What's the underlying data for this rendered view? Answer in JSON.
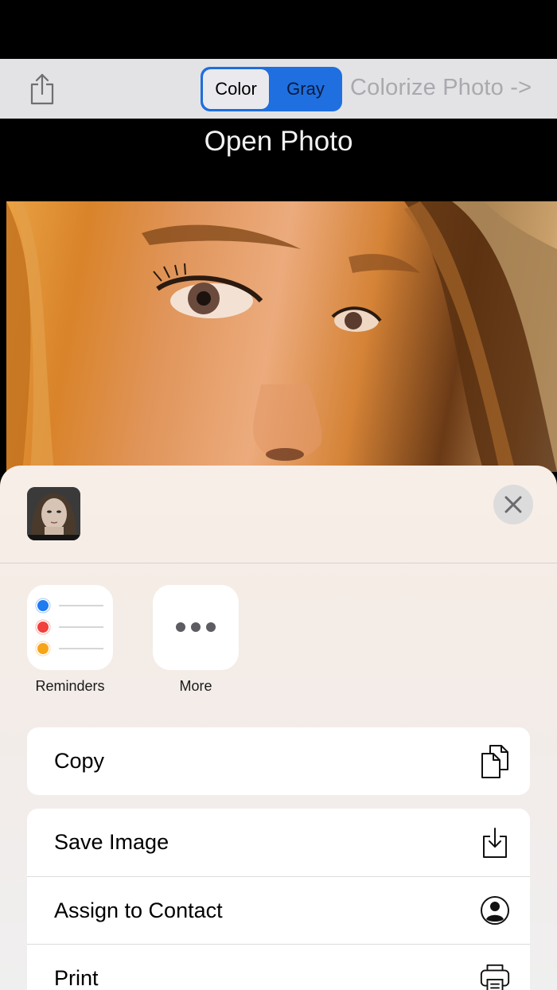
{
  "toolbar": {
    "share_icon": "share-icon",
    "segment_color": "Color",
    "segment_gray": "Gray",
    "selected_segment": "Color",
    "colorize_label": "Colorize Photo ->",
    "accent": "#1f6fe0"
  },
  "main": {
    "open_photo_label": "Open Photo"
  },
  "share_sheet": {
    "close_icon": "close-icon",
    "apps": [
      {
        "label": "Reminders",
        "icon": "reminders-icon"
      },
      {
        "label": "More",
        "icon": "more-icon"
      }
    ],
    "actions_group1": [
      {
        "label": "Copy",
        "icon": "copy-icon"
      }
    ],
    "actions_group2": [
      {
        "label": "Save Image",
        "icon": "save-image-icon"
      },
      {
        "label": "Assign to Contact",
        "icon": "contact-icon"
      },
      {
        "label": "Print",
        "icon": "print-icon"
      }
    ]
  }
}
